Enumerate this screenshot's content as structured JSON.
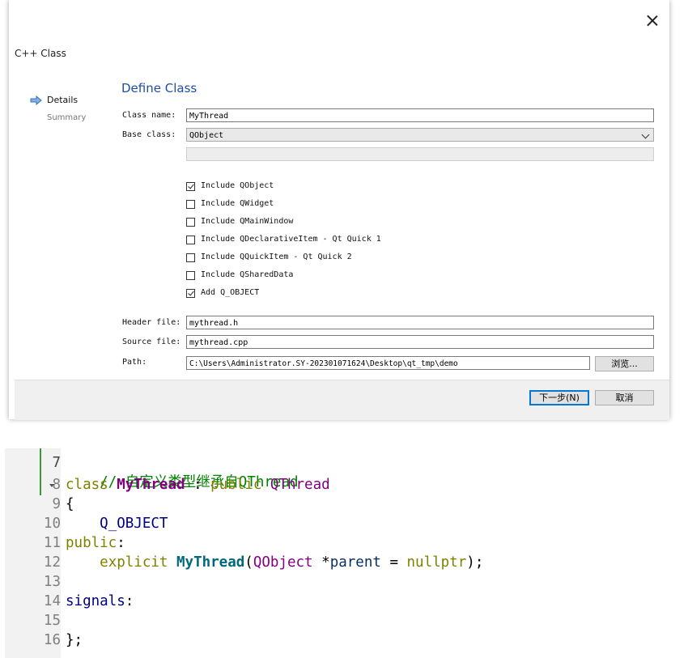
{
  "dialog": {
    "window_title": "C++ Class",
    "steps": [
      {
        "label": "Details",
        "active": true
      },
      {
        "label": "Summary",
        "active": false
      }
    ],
    "page_title": "Define Class",
    "class_name_label": "Class name:",
    "class_name_value": "MyThread",
    "base_class_label": "Base class:",
    "base_class_value": "QObject",
    "checkboxes": [
      {
        "label": "Include QObject",
        "checked": true
      },
      {
        "label": "Include QWidget",
        "checked": false
      },
      {
        "label": "Include QMainWindow",
        "checked": false
      },
      {
        "label": "Include QDeclarativeItem - Qt Quick 1",
        "checked": false
      },
      {
        "label": "Include QQuickItem - Qt Quick 2",
        "checked": false
      },
      {
        "label": "Include QSharedData",
        "checked": false
      },
      {
        "label": "Add Q_OBJECT",
        "checked": true
      }
    ],
    "header_file_label": "Header file:",
    "header_file_value": "mythread.h",
    "source_file_label": "Source file:",
    "source_file_value": "mythread.cpp",
    "path_label": "Path:",
    "path_value": "C:\\Users\\Administrator.SY-202301071624\\Desktop\\qt_tmp\\demo",
    "browse_label": "浏览...",
    "next_label": "下一步(N)",
    "cancel_label": "取消"
  },
  "editor": {
    "line_numbers": [
      "7",
      "8",
      "9",
      "10",
      "11",
      "12",
      "13",
      "14",
      "15",
      "16"
    ],
    "current_line": "7",
    "tokens": {
      "comment": "// 自定义类型继承自QThread",
      "kw_class": "class",
      "class_name": "MyThread",
      "colon": " : ",
      "kw_public": "public",
      "base": "QThread",
      "brace_open": "{",
      "macro": "Q_OBJECT",
      "public_label": "public",
      "colon2": ":",
      "kw_explicit": "explicit",
      "ctor": "MyThread",
      "paren_open": "(",
      "param_type": "QObject",
      "param_rest": " *",
      "param_name": "parent",
      "eq": " = ",
      "nullptr": "nullptr",
      "end_sig": ");",
      "signals": "signals",
      "colon3": ":",
      "brace_close": "};"
    }
  },
  "colors": {
    "accent_title": "#1f4e9e",
    "comment": "#008000",
    "keyword": "#808000",
    "class_name": "#800080",
    "function": "#00677c",
    "gutter_marker": "#3a9a3a"
  },
  "icons": [
    "close-icon",
    "step-arrow-icon",
    "chevron-down-icon",
    "checkbox-icon",
    "fold-arrow-icon"
  ]
}
